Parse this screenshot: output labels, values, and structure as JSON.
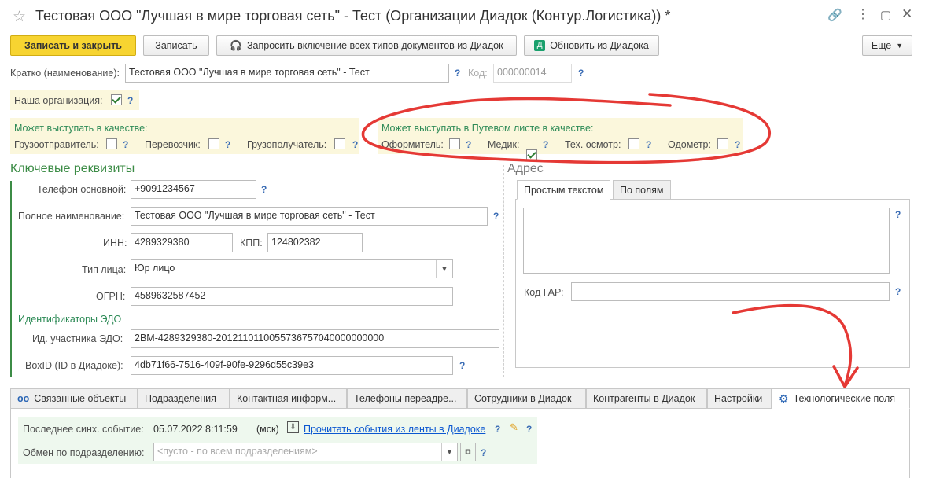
{
  "window": {
    "title": "Тестовая ООО \"Лучшая в мире торговая сеть\" - Тест (Организации Диадок (Контур.Логистика)) *"
  },
  "toolbar": {
    "save_close": "Записать и закрыть",
    "save": "Записать",
    "request_all": "Запросить включение всех типов документов из Диадок",
    "refresh": "Обновить из Диадока",
    "more": "Еще"
  },
  "header": {
    "short_name_label": "Кратко (наименование):",
    "short_name_value": "Тестовая ООО \"Лучшая в мире торговая сеть\" - Тест",
    "code_label": "Код:",
    "code_value": "000000014",
    "our_org_label": "Наша организация:",
    "our_org_checked": true
  },
  "roles": {
    "title": "Может выступать в качестве:",
    "shipper": "Грузоотправитель:",
    "carrier": "Перевозчик:",
    "consignee": "Грузополучатель:"
  },
  "waybill_roles": {
    "title": "Может выступать в Путевом листе в качестве:",
    "issuer": "Оформитель:",
    "medic": "Медик:",
    "medic_checked": true,
    "tech": "Тех. осмотр:",
    "odometer": "Одометр:"
  },
  "key_details": {
    "title": "Ключевые реквизиты",
    "phone_label": "Телефон основной:",
    "phone_value": "+9091234567",
    "full_name_label": "Полное наименование:",
    "full_name_value": "Тестовая ООО \"Лучшая в мире торговая сеть\" - Тест",
    "inn_label": "ИНН:",
    "inn_value": "4289329380",
    "kpp_label": "КПП:",
    "kpp_value": "124802382",
    "person_type_label": "Тип лица:",
    "person_type_value": "Юр лицо",
    "ogrn_label": "ОГРН:",
    "ogrn_value": "4589632587452",
    "edo_title": "Идентификаторы ЭДО",
    "edo_id_label": "Ид. участника ЭДО:",
    "edo_id_value": "2BM-4289329380-2012110110055736757040000000000",
    "boxid_label": "BoxID (ID в Диадоке):",
    "boxid_value": "4db71f66-7516-409f-90fe-9296d55c39e3"
  },
  "address": {
    "title": "Адрес",
    "tab_plain": "Простым текстом",
    "tab_fields": "По полям",
    "gar_label": "Код ГАР:"
  },
  "bottom_tabs": [
    {
      "label": "Связанные объекты"
    },
    {
      "label": "Подразделения"
    },
    {
      "label": "Контактная информ..."
    },
    {
      "label": "Телефоны переадре..."
    },
    {
      "label": "Сотрудники в Диадок"
    },
    {
      "label": "Контрагенты в Диадок"
    },
    {
      "label": "Настройки"
    },
    {
      "label": "Технологические поля"
    }
  ],
  "tech": {
    "last_event_label": "Последнее синх. событие:",
    "last_event_value": "05.07.2022 8:11:59",
    "tz": "(мск)",
    "read_events_link": "Прочитать события из ленты в Диадоке",
    "dept_label": "Обмен по подразделению:",
    "dept_placeholder": "<пусто - по всем подразделениям>"
  },
  "colors": {
    "primary_button": "#f7d431",
    "annotation": "#e53935",
    "section_green": "#3c8c46",
    "help_blue": "#3b6db5"
  }
}
